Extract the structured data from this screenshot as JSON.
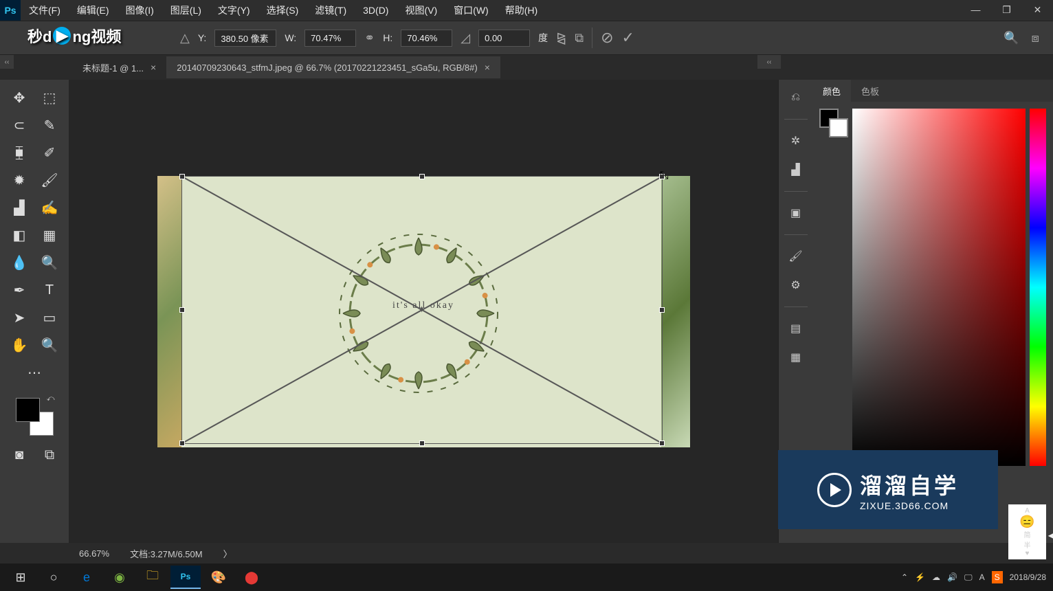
{
  "app": {
    "logo": "Ps"
  },
  "menu": {
    "file": "文件(F)",
    "edit": "编辑(E)",
    "image": "图像(I)",
    "layer": "图层(L)",
    "type": "文字(Y)",
    "select": "选择(S)",
    "filter": "滤镜(T)",
    "threeD": "3D(D)",
    "view": "视图(V)",
    "window": "窗口(W)",
    "help": "帮助(H)"
  },
  "window_controls": {
    "min": "—",
    "max": "❐",
    "close": "✕"
  },
  "options_bar": {
    "y_label": "Y:",
    "y_value": "380.50 像素",
    "w_label": "W:",
    "w_value": "70.47%",
    "h_label": "H:",
    "h_value": "70.46%",
    "rot_value": "0.00",
    "deg": "度"
  },
  "logo_overlay": {
    "a": "秒d",
    "b": "ng视频"
  },
  "tabs": {
    "tab1": "未标题-1 @ 1...",
    "tab2": "20140709230643_stfmJ.jpeg @ 66.7% (20170221223451_sGa5u, RGB/8#)"
  },
  "panels": {
    "color": "颜色",
    "swatches": "色板"
  },
  "status": {
    "zoom": "66.67%",
    "doc_label": "文档:",
    "doc_value": "3.27M/6.50M",
    "arrow": "〉"
  },
  "canvas": {
    "text": "it's all okay"
  },
  "watermark": {
    "title": "溜溜自学",
    "url": "ZIXUE.3D66.COM"
  },
  "avatar": {
    "line1": "A",
    "line2": "简",
    "line3": "半"
  },
  "taskbar": {
    "datetime": "2018/9/28"
  }
}
